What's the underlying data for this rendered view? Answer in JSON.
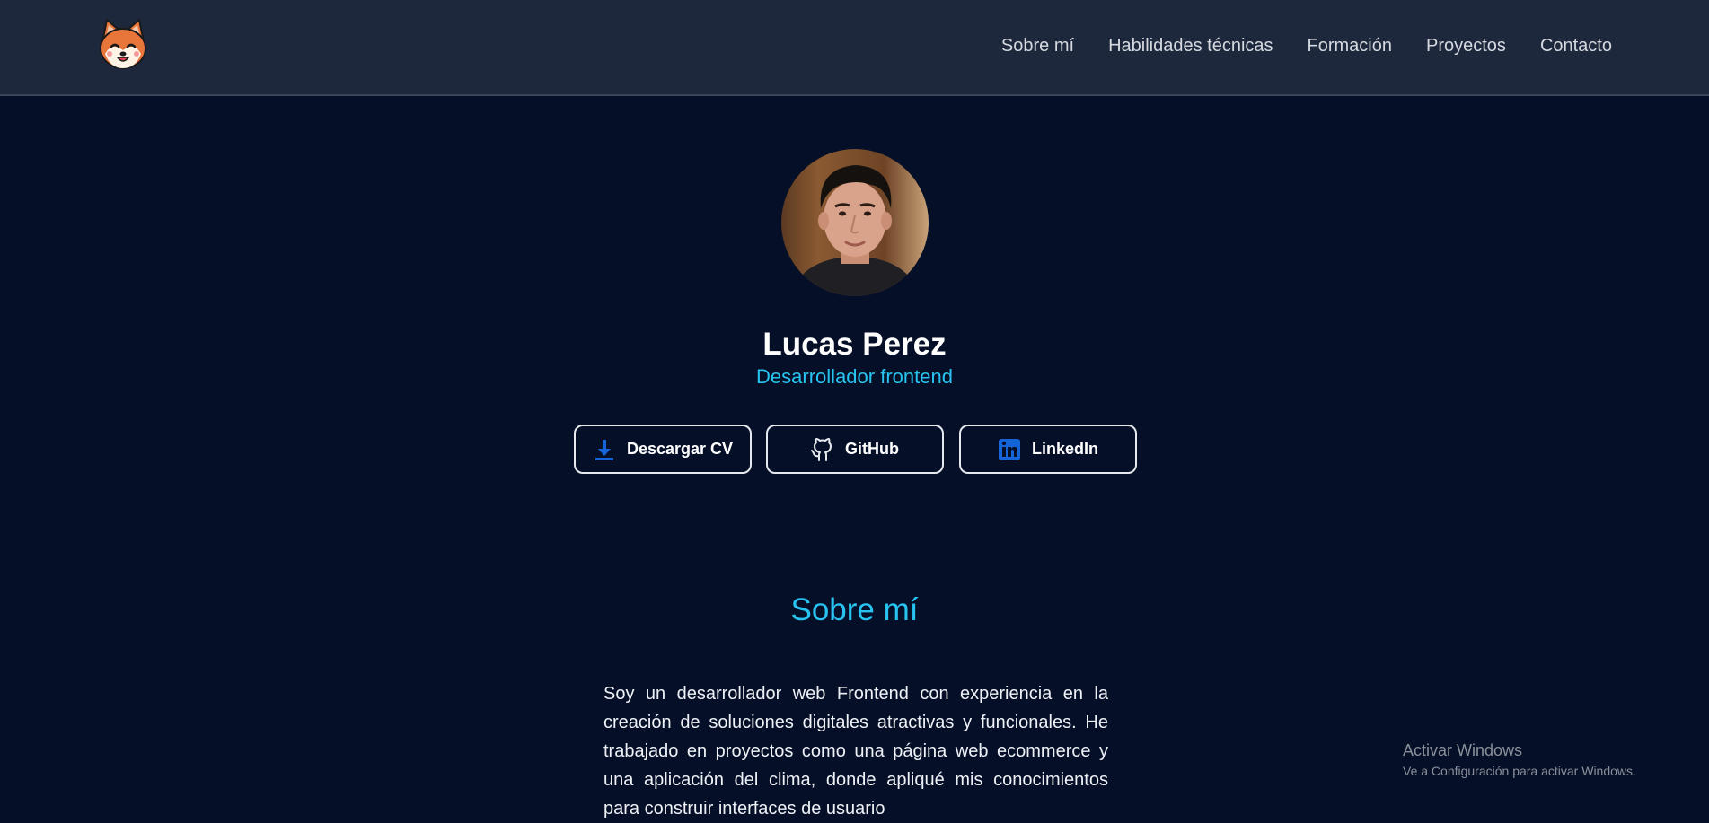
{
  "nav": {
    "logo_alt": "Shiba logo",
    "links": [
      "Sobre mí",
      "Habilidades técnicas",
      "Formación",
      "Proyectos",
      "Contacto"
    ]
  },
  "profile": {
    "name": "Lucas Perez",
    "role": "Desarrollador frontend"
  },
  "buttons": {
    "cv": "Descargar CV",
    "github": "GitHub",
    "linkedin": "LinkedIn"
  },
  "about": {
    "title": "Sobre mí",
    "text": "Soy un desarrollador web Frontend con experiencia en la creación de soluciones digitales atractivas y funcionales. He trabajado en proyectos como una página web ecommerce y una aplicación del clima, donde apliqué mis conocimientos para construir interfaces de usuario"
  },
  "watermark": {
    "line1": "Activar Windows",
    "line2": "Ve a Configuración para activar Windows."
  },
  "colors": {
    "background": "#050f27",
    "navbar": "#1d283d",
    "accent": "#28c3f0",
    "icon_blue": "#1565d8"
  }
}
